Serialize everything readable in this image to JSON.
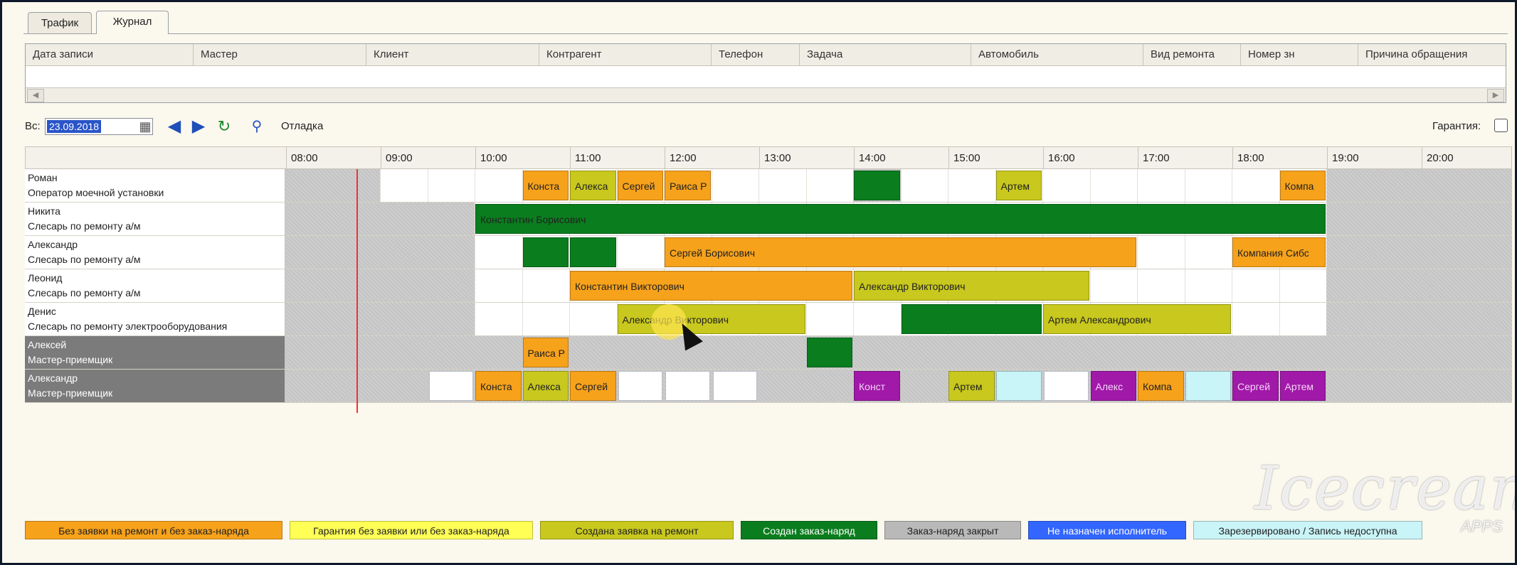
{
  "tabs": [
    "Трафик",
    "Журнал"
  ],
  "journal": {
    "columns": [
      "Дата записи",
      "Мастер",
      "Клиент",
      "Контрагент",
      "Телефон",
      "Задача",
      "Автомобиль",
      "Вид ремонта",
      "Номер зн",
      "Причина обращения"
    ]
  },
  "toolbar": {
    "date_label": "Вс:",
    "date_value": "23.09.2018",
    "debug_label": "Отладка",
    "warranty_label": "Гарантия:",
    "warranty_checked": false
  },
  "hours": [
    "08:00",
    "09:00",
    "10:00",
    "11:00",
    "12:00",
    "13:00",
    "14:00",
    "15:00",
    "16:00",
    "17:00",
    "18:00",
    "19:00",
    "20:00"
  ],
  "colors": {
    "orange": "#f7a21b",
    "yellow": "#ffff55",
    "olive": "#c8c81e",
    "green": "#0a7d1e",
    "gray": "#b9b9b9",
    "blue": "#3366ff",
    "cyan": "#c9f4f8",
    "purple": "#a019a8",
    "unavailable": "#c8c8c8",
    "available": "#ffffff"
  },
  "rows": [
    {
      "name": "Роман",
      "role": "Оператор моечной установки",
      "dark": false,
      "avail": [
        [
          9,
          14
        ],
        [
          14.5,
          19
        ]
      ],
      "bars": [
        {
          "start": 10.5,
          "end": 11,
          "color": "orange",
          "label": "Конста"
        },
        {
          "start": 11,
          "end": 11.5,
          "color": "olive",
          "label": "Алекса"
        },
        {
          "start": 11.5,
          "end": 12,
          "color": "orange",
          "label": "Сергей"
        },
        {
          "start": 12,
          "end": 12.5,
          "color": "orange",
          "label": "Раиса Р"
        },
        {
          "start": 14,
          "end": 14.5,
          "color": "green",
          "label": ""
        },
        {
          "start": 15.5,
          "end": 16,
          "color": "olive",
          "label": "Артем"
        },
        {
          "start": 18.5,
          "end": 19,
          "color": "orange",
          "label": "Компа"
        }
      ]
    },
    {
      "name": "Никита",
      "role": "Слесарь по ремонту а/м",
      "dark": false,
      "avail": [
        [
          10,
          19
        ]
      ],
      "bars": [
        {
          "start": 10,
          "end": 19,
          "color": "green",
          "label": "Константин Борисович"
        }
      ]
    },
    {
      "name": "Александр",
      "role": "Слесарь по ремонту а/м",
      "dark": false,
      "avail": [
        [
          10,
          19
        ]
      ],
      "bars": [
        {
          "start": 10.5,
          "end": 11,
          "color": "green",
          "label": ""
        },
        {
          "start": 11,
          "end": 11.5,
          "color": "green",
          "label": ""
        },
        {
          "start": 12,
          "end": 17,
          "color": "orange",
          "label": "Сергей Борисович"
        },
        {
          "start": 18,
          "end": 19,
          "color": "orange",
          "label": "Компания Сибс"
        }
      ]
    },
    {
      "name": "Леонид",
      "role": "Слесарь по ремонту а/м",
      "dark": false,
      "avail": [
        [
          10,
          19
        ]
      ],
      "bars": [
        {
          "start": 11,
          "end": 14,
          "color": "orange",
          "label": "Константин Викторович"
        },
        {
          "start": 14,
          "end": 16.5,
          "color": "olive",
          "label": "Александр Викторович"
        }
      ]
    },
    {
      "name": "Денис",
      "role": "Слесарь по ремонту электрооборудования",
      "dark": false,
      "avail": [
        [
          10,
          19
        ]
      ],
      "bars": [
        {
          "start": 11.5,
          "end": 13.5,
          "color": "olive",
          "label": "Александр Викторович"
        },
        {
          "start": 14.5,
          "end": 16,
          "color": "green",
          "label": ""
        },
        {
          "start": 16,
          "end": 18,
          "color": "olive",
          "label": "Артем Александрович"
        }
      ]
    },
    {
      "name": "Алексей",
      "role": "Мастер-приемщик",
      "dark": true,
      "avail": [],
      "bars": [
        {
          "start": 10.5,
          "end": 11,
          "color": "orange",
          "label": "Раиса Р"
        },
        {
          "start": 13.5,
          "end": 14,
          "color": "green",
          "label": ""
        }
      ]
    },
    {
      "name": "Александр",
      "role": "Мастер-приемщик",
      "dark": true,
      "avail": [],
      "slots": [
        9.5,
        11.5,
        12,
        12.5,
        15.5,
        16
      ],
      "bars": [
        {
          "start": 10,
          "end": 10.5,
          "color": "orange",
          "label": "Конста"
        },
        {
          "start": 10.5,
          "end": 11,
          "color": "olive",
          "label": "Алекса"
        },
        {
          "start": 11,
          "end": 11.5,
          "color": "orange",
          "label": "Сергей"
        },
        {
          "start": 14,
          "end": 14.5,
          "color": "purple",
          "label": "Конст"
        },
        {
          "start": 15,
          "end": 15.5,
          "color": "olive",
          "label": "Артем"
        },
        {
          "start": 15.5,
          "end": 16,
          "color": "cyan",
          "label": ""
        },
        {
          "start": 16.5,
          "end": 17,
          "color": "purple",
          "label": "Алекс"
        },
        {
          "start": 17,
          "end": 17.5,
          "color": "orange",
          "label": "Компа"
        },
        {
          "start": 17.5,
          "end": 18,
          "color": "cyan",
          "label": ""
        },
        {
          "start": 18,
          "end": 18.5,
          "color": "purple",
          "label": "Сергей"
        },
        {
          "start": 18.5,
          "end": 19,
          "color": "purple",
          "label": "Артем"
        }
      ]
    }
  ],
  "now_hour": 8.75,
  "legend": [
    {
      "label": "Без заявки на ремонт и без заказ-наряда",
      "color": "orange"
    },
    {
      "label": "Гарантия без заявки или без заказ-наряда",
      "color": "yellow"
    },
    {
      "label": "Создана заявка на ремонт",
      "color": "olive"
    },
    {
      "label": "Создан заказ-наряд",
      "color": "green"
    },
    {
      "label": "Заказ-наряд закрыт",
      "color": "gray"
    },
    {
      "label": "Не назначен исполнитель",
      "color": "blue"
    },
    {
      "label": "Зарезервировано / Запись недоступна",
      "color": "cyan"
    }
  ],
  "watermark": {
    "brand": "Icecream",
    "sub": "APPS"
  }
}
